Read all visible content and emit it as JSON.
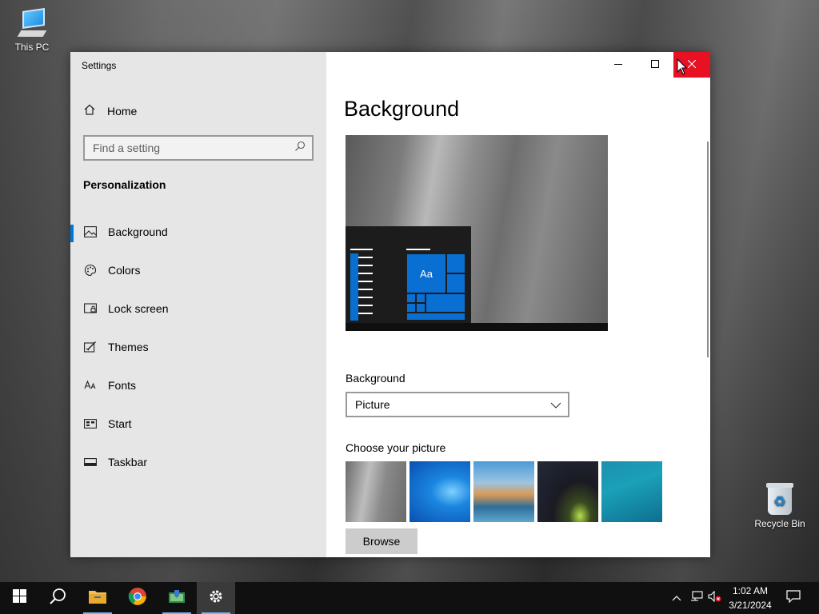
{
  "desktop": {
    "icons": [
      {
        "label": "This PC"
      },
      {
        "label": "Recycle Bin"
      }
    ]
  },
  "window": {
    "title": "Settings",
    "controls": {
      "minimize": "minimize-icon",
      "maximize": "maximize-icon",
      "close": "close-icon"
    }
  },
  "sidebar": {
    "home_label": "Home",
    "search": {
      "placeholder": "Find a setting",
      "value": ""
    },
    "section_title": "Personalization",
    "items": [
      {
        "label": "Background",
        "icon": "picture-icon",
        "active": true
      },
      {
        "label": "Colors",
        "icon": "palette-icon",
        "active": false
      },
      {
        "label": "Lock screen",
        "icon": "lock-screen-icon",
        "active": false
      },
      {
        "label": "Themes",
        "icon": "themes-icon",
        "active": false
      },
      {
        "label": "Fonts",
        "icon": "fonts-icon",
        "active": false
      },
      {
        "label": "Start",
        "icon": "start-icon",
        "active": false
      },
      {
        "label": "Taskbar",
        "icon": "taskbar-icon",
        "active": false
      }
    ]
  },
  "content": {
    "title": "Background",
    "preview": {
      "tile_label": "Aa"
    },
    "background_label": "Background",
    "background_select": {
      "value": "Picture"
    },
    "choose_label": "Choose your picture",
    "pictures": [
      "cliff-picture",
      "windows-blue-picture",
      "beach-rocks-picture",
      "night-sky-tent-picture",
      "underwater-swimmer-picture"
    ],
    "browse_label": "Browse"
  },
  "taskbar": {
    "apps": [
      "start-icon",
      "search-icon",
      "file-explorer-icon",
      "chrome-icon",
      "app-icon",
      "settings-icon"
    ],
    "active_app": "settings-icon",
    "clock": {
      "time": "1:02 AM",
      "date": "3/21/2024"
    }
  },
  "colors": {
    "accent": "#0078d7",
    "close_button": "#e81123",
    "sidebar_bg": "#e6e6e6",
    "taskbar_bg": "#101010"
  }
}
